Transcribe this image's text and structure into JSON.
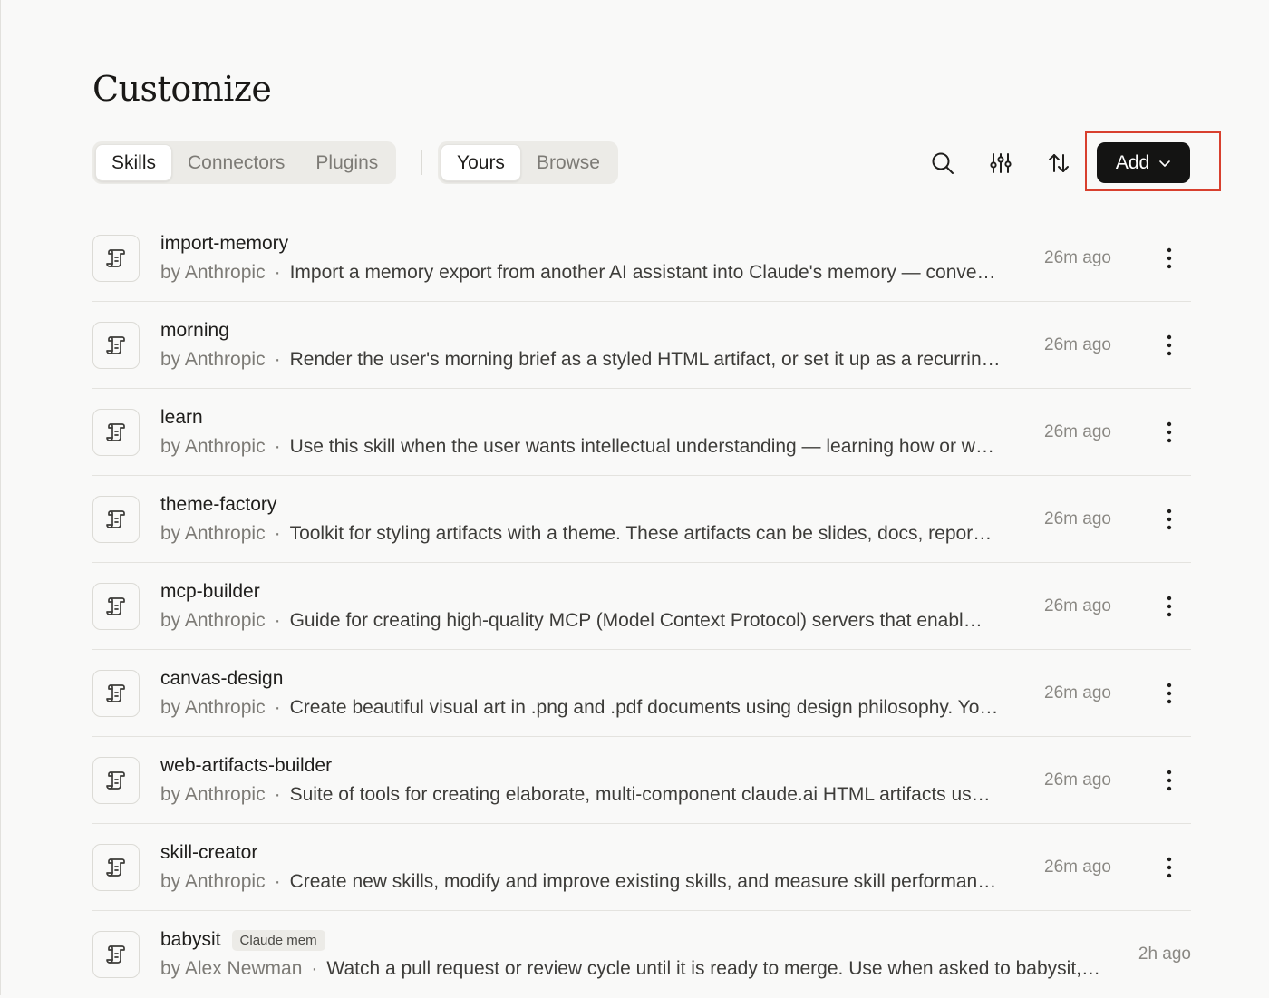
{
  "page": {
    "title": "Customize"
  },
  "category_tabs": [
    {
      "label": "Skills",
      "active": true
    },
    {
      "label": "Connectors",
      "active": false
    },
    {
      "label": "Plugins",
      "active": false
    }
  ],
  "scope_tabs": [
    {
      "label": "Yours",
      "active": true
    },
    {
      "label": "Browse",
      "active": false
    }
  ],
  "toolbar": {
    "search_icon": "search-icon",
    "filter_icon": "sliders-icon",
    "sort_icon": "sort-arrows-icon",
    "add_label": "Add",
    "add_icon": "chevron-down-icon"
  },
  "skills": [
    {
      "name": "import-memory",
      "author": "by Anthropic",
      "separator": "·",
      "description": "Import a memory export from another AI assistant into Claude's memory — conve…",
      "time": "26m ago"
    },
    {
      "name": "morning",
      "author": "by Anthropic",
      "separator": "·",
      "description": "Render the user's morning brief as a styled HTML artifact, or set it up as a recurrin…",
      "time": "26m ago"
    },
    {
      "name": "learn",
      "author": "by Anthropic",
      "separator": "·",
      "description": "Use this skill when the user wants intellectual understanding — learning how or w…",
      "time": "26m ago"
    },
    {
      "name": "theme-factory",
      "author": "by Anthropic",
      "separator": "·",
      "description": "Toolkit for styling artifacts with a theme. These artifacts can be slides, docs, repor…",
      "time": "26m ago"
    },
    {
      "name": "mcp-builder",
      "author": "by Anthropic",
      "separator": "·",
      "description": "Guide for creating high-quality MCP (Model Context Protocol) servers that enabl…",
      "time": "26m ago"
    },
    {
      "name": "canvas-design",
      "author": "by Anthropic",
      "separator": "·",
      "description": "Create beautiful visual art in .png and .pdf documents using design philosophy. Yo…",
      "time": "26m ago"
    },
    {
      "name": "web-artifacts-builder",
      "author": "by Anthropic",
      "separator": "·",
      "description": "Suite of tools for creating elaborate, multi-component claude.ai HTML artifacts us…",
      "time": "26m ago"
    },
    {
      "name": "skill-creator",
      "author": "by Anthropic",
      "separator": "·",
      "description": "Create new skills, modify and improve existing skills, and measure skill performan…",
      "time": "26m ago"
    },
    {
      "name": "babysit",
      "tag": "Claude mem",
      "author": "by Alex Newman",
      "separator": "·",
      "description": "Watch a pull request or review cycle until it is ready to merge. Use when asked to babysit,…",
      "time": "2h ago"
    }
  ],
  "row_icon": "scroll-icon",
  "row_menu_icon": "more-vertical-icon",
  "colors": {
    "accent": "#141413",
    "highlight": "#d8402e",
    "background": "#f9f9f8"
  }
}
